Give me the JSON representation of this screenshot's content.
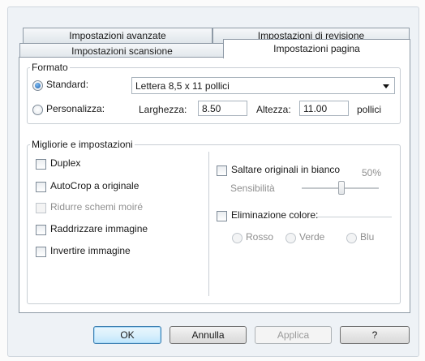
{
  "tabs": {
    "row1": [
      "Impostazioni avanzate",
      "Impostazioni di revisione"
    ],
    "row2": [
      "Impostazioni scansione",
      "Impostazioni pagina"
    ]
  },
  "formato": {
    "title": "Formato",
    "standard_label": "Standard:",
    "standard_value": "Lettera 8,5 x 11 pollici",
    "custom_label": "Personalizza:",
    "width_label": "Larghezza:",
    "width_value": "8.50",
    "height_label": "Altezza:",
    "height_value": "11.00",
    "unit": "pollici"
  },
  "enhancements": {
    "title": "Migliorie e impostazioni",
    "left": [
      "Duplex",
      "AutoCrop a originale",
      "Ridurre schemi moiré",
      "Raddrizzare immagine",
      "Invertire immagine"
    ],
    "skip_blank_label": "Saltare originali in bianco",
    "sensitivity_label": "Sensibilità",
    "sensitivity_value": "50%",
    "sensitivity_fraction": 0.5,
    "color_drop_label": "Eliminazione colore:",
    "colors": [
      "Rosso",
      "Verde",
      "Blu"
    ]
  },
  "buttons": {
    "ok": "OK",
    "cancel": "Annulla",
    "apply": "Applica",
    "help": "?"
  }
}
